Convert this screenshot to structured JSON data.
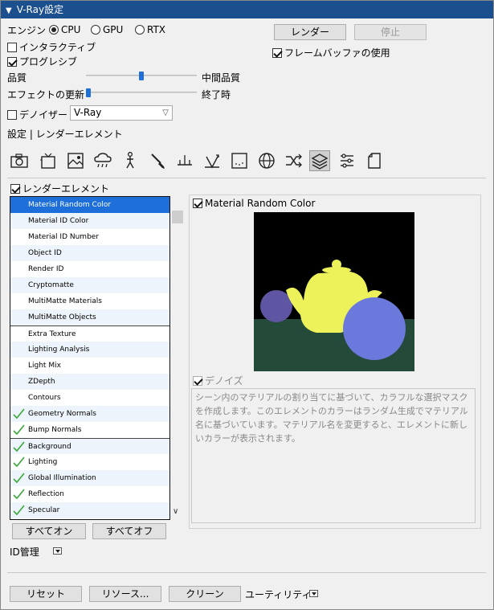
{
  "window": {
    "title": "V-Ray設定"
  },
  "engine": {
    "label": "エンジン",
    "options": [
      "CPU",
      "GPU",
      "RTX"
    ],
    "selected": "CPU"
  },
  "buttons": {
    "render": "レンダー",
    "stop": "停止"
  },
  "checks": {
    "interactive": "インタラクティブ",
    "progressive": "プログレシブ",
    "framebuffer": "フレームバッファの使用"
  },
  "sliders": {
    "quality": {
      "label": "品質",
      "value_label": "中間品質",
      "level": 0.5
    },
    "effects": {
      "label": "エフェクトの更新",
      "value_label": "終了時",
      "level": 0.02
    }
  },
  "denoiser": {
    "label": "デノイザー",
    "value": "V-Ray"
  },
  "breadcrumb": "設定 | レンダーエレメント",
  "section": {
    "label": "レンダーエレメント"
  },
  "elements": [
    {
      "label": "Material Random Color",
      "checked": false
    },
    {
      "label": "Material ID Color",
      "checked": false
    },
    {
      "label": "Material ID Number",
      "checked": false
    },
    {
      "label": "Object ID",
      "checked": false
    },
    {
      "label": "Render ID",
      "checked": false
    },
    {
      "label": "Cryptomatte",
      "checked": false
    },
    {
      "label": "MultiMatte Materials",
      "checked": false
    },
    {
      "label": "MultiMatte Objects",
      "checked": false
    },
    {
      "label": "Extra Texture",
      "checked": false
    },
    {
      "label": "Lighting Analysis",
      "checked": false
    },
    {
      "label": "Light Mix",
      "checked": false
    },
    {
      "label": "ZDepth",
      "checked": false
    },
    {
      "label": "Contours",
      "checked": false
    },
    {
      "label": "Geometry Normals",
      "checked": true
    },
    {
      "label": "Bump Normals",
      "checked": true
    },
    {
      "label": "Background",
      "checked": true
    },
    {
      "label": "Lighting",
      "checked": true
    },
    {
      "label": "Global Illumination",
      "checked": true
    },
    {
      "label": "Reflection",
      "checked": true
    },
    {
      "label": "Specular",
      "checked": true
    }
  ],
  "detail": {
    "title": "Material Random Color",
    "denoise": "デノイズ",
    "description": "シーン内のマテリアルの割り当てに基づいて、カラフルな選択マスクを作成します。このエレメントのカラーはランダム生成でマテリアル名に基づいています。マテリアル名を変更すると、エレメントに新しいカラーが表示されます。"
  },
  "list_buttons": {
    "all_on": "すべてオン",
    "all_off": "すべてオフ"
  },
  "id_manage": "ID管理",
  "footer": {
    "reset": "リセット",
    "resources": "リソース...",
    "clean": "クリーン",
    "utilities": "ユーティリティ"
  },
  "colors": {
    "titlebar": "#1c4f8e",
    "selection": "#1e6fd9",
    "teapot": "#eef25a",
    "sphere_right": "#6b78dc",
    "sphere_left": "#5e56a3",
    "floor": "#244a3a"
  }
}
